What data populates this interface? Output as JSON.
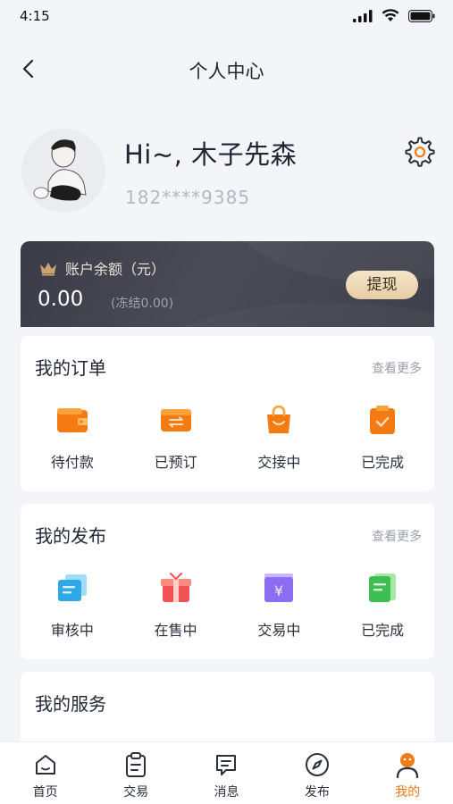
{
  "status_bar": {
    "time": "4:15"
  },
  "nav": {
    "title": "个人中心"
  },
  "profile": {
    "greeting": "Hi~, 木子先森",
    "phone": "182****9385"
  },
  "balance": {
    "title": "账户余额（元）",
    "amount": "0.00",
    "frozen": "(冻结0.00)",
    "withdraw_label": "提现"
  },
  "orders": {
    "title": "我的订单",
    "more": "查看更多",
    "items": [
      {
        "label": "待付款",
        "icon": "wallet-icon"
      },
      {
        "label": "已预订",
        "icon": "exchange-card-icon"
      },
      {
        "label": "交接中",
        "icon": "shopping-bag-icon"
      },
      {
        "label": "已完成",
        "icon": "clipboard-check-icon"
      }
    ]
  },
  "posts": {
    "title": "我的发布",
    "more": "查看更多",
    "items": [
      {
        "label": "审核中",
        "icon": "document-stack-icon"
      },
      {
        "label": "在售中",
        "icon": "gift-box-icon"
      },
      {
        "label": "交易中",
        "icon": "yuan-card-icon"
      },
      {
        "label": "已完成",
        "icon": "green-book-icon"
      }
    ]
  },
  "services": {
    "title": "我的服务"
  },
  "tabbar": {
    "items": [
      {
        "label": "首页",
        "icon": "home-icon",
        "active": false
      },
      {
        "label": "交易",
        "icon": "clipboard-icon",
        "active": false
      },
      {
        "label": "消息",
        "icon": "message-icon",
        "active": false
      },
      {
        "label": "发布",
        "icon": "compass-icon",
        "active": false
      },
      {
        "label": "我的",
        "icon": "user-icon",
        "active": true
      }
    ]
  },
  "colors": {
    "accent": "#f07a15",
    "balance_bg": "#3f404b",
    "withdraw_bg": "#ecd6b0"
  }
}
